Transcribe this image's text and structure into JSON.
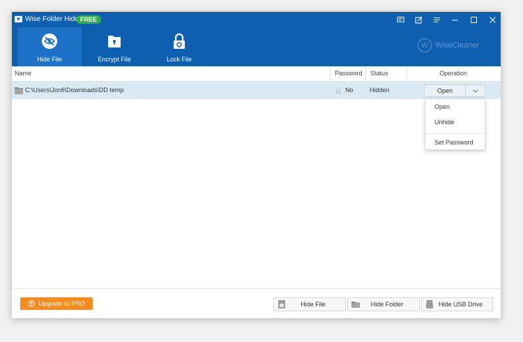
{
  "app": {
    "title": "Wise Folder Hider",
    "badge": "FREE"
  },
  "tabs": [
    {
      "label": "Hide File",
      "icon": "eye-slash-icon",
      "active": true
    },
    {
      "label": "Encrypt File",
      "icon": "file-key-icon",
      "active": false
    },
    {
      "label": "Lock File",
      "icon": "lock-icon",
      "active": false
    }
  ],
  "brand": {
    "letter": "W",
    "text": "WiseCleaner"
  },
  "columns": {
    "name": "Name",
    "password": "Password",
    "status": "Status",
    "operation": "Operation"
  },
  "rows": [
    {
      "path": "C:\\Users\\Jonfi\\Downloads\\DD temp",
      "password": "No",
      "status": "Hidden",
      "operation": "Open"
    }
  ],
  "dropdown": {
    "items": [
      "Open",
      "Unhide",
      "Set Password"
    ]
  },
  "footer": {
    "upgrade": "Upgrade to PRO",
    "hide_file": "Hide File",
    "hide_folder": "Hide Folder",
    "hide_usb": "Hide USB Drive"
  },
  "colors": {
    "header": "#0e5fb0",
    "active_tab": "#1d72c8",
    "row_selected": "#daeaf5",
    "upgrade": "#f58a1f",
    "badge": "#2db24a"
  }
}
